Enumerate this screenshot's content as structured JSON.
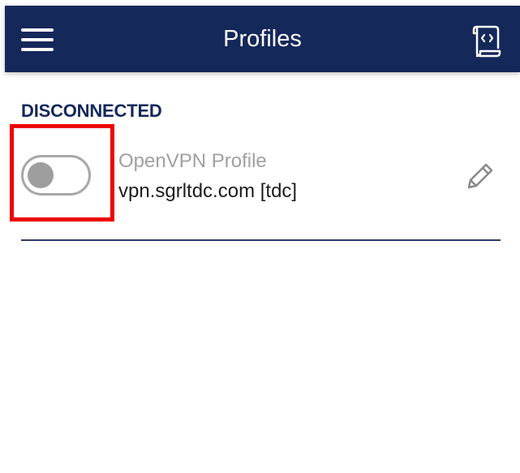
{
  "header": {
    "title": "Profiles",
    "background_color": "#15285a",
    "menu_icon": "hamburger-menu-icon",
    "import_icon": "import-profile-icon"
  },
  "status": {
    "label": "DISCONNECTED",
    "color": "#15285a"
  },
  "profile": {
    "name": "OpenVPN Profile",
    "server": "vpn.sgrltdc.com [tdc]",
    "connected": false,
    "edit_icon": "pencil-edit-icon"
  },
  "highlight_color": "#ee0000"
}
